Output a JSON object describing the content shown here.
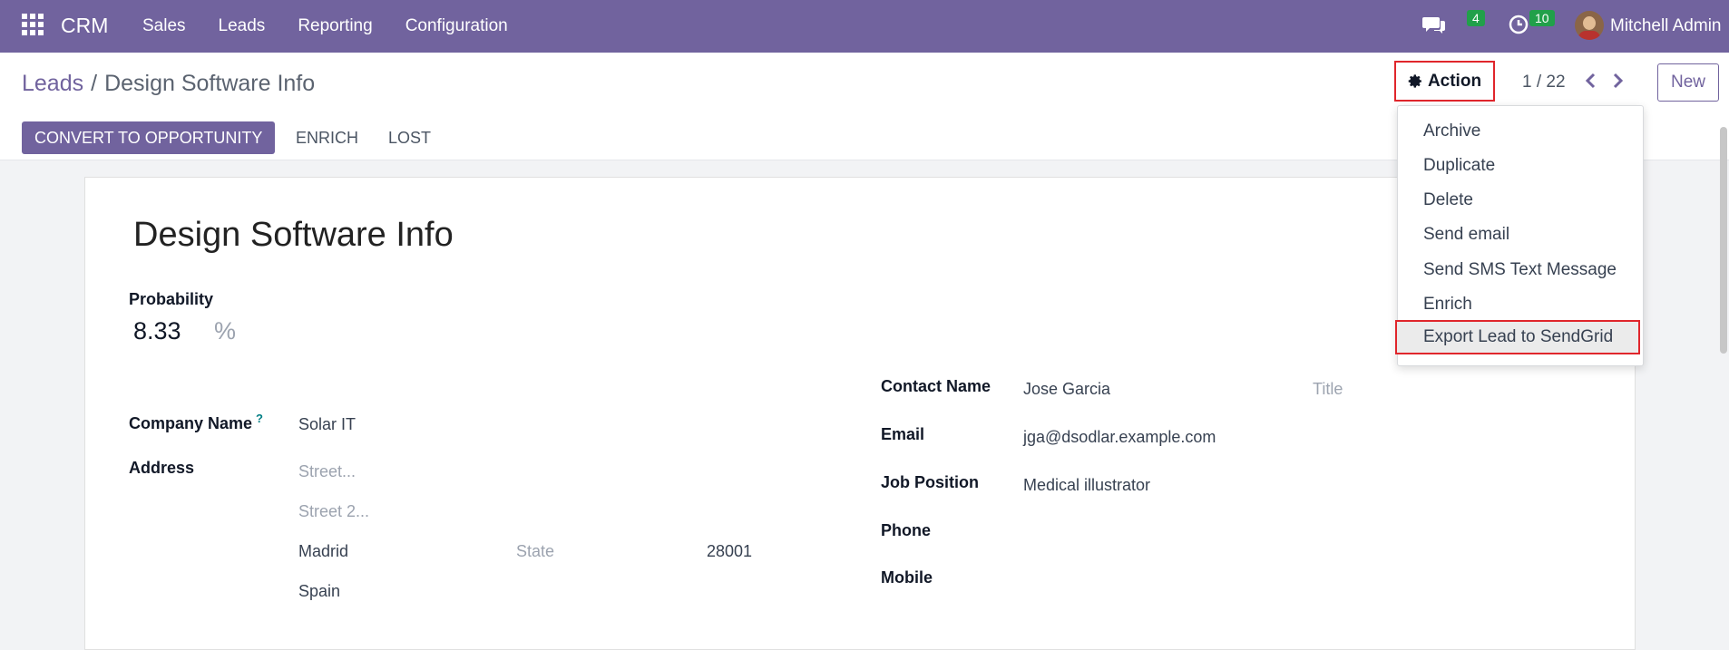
{
  "navbar": {
    "brand": "CRM",
    "menu": [
      "Sales",
      "Leads",
      "Reporting",
      "Configuration"
    ],
    "chat_badge": "4",
    "activity_badge": "10",
    "user": "Mitchell Admin"
  },
  "breadcrumb": {
    "parent": "Leads",
    "separator": "/",
    "current": "Design Software Info"
  },
  "control": {
    "action_label": "Action",
    "pager": "1 / 22",
    "new_label": "New"
  },
  "status_buttons": {
    "convert": "CONVERT TO OPPORTUNITY",
    "enrich": "ENRICH",
    "lost": "LOST"
  },
  "form": {
    "title": "Design Software Info",
    "probability_label": "Probability",
    "probability_value": "8.33",
    "probability_unit": "%",
    "company_label": "Company Name",
    "company_help": "?",
    "company_value": "Solar IT",
    "address_label": "Address",
    "street_placeholder": "Street...",
    "street2_placeholder": "Street 2...",
    "city": "Madrid",
    "state_placeholder": "State",
    "zip": "28001",
    "country": "Spain",
    "contact_label": "Contact Name",
    "contact_value": "Jose Garcia",
    "title_placeholder": "Title",
    "email_label": "Email",
    "email_value": "jga@dsodlar.example.com",
    "job_label": "Job Position",
    "job_value": "Medical illustrator",
    "phone_label": "Phone",
    "mobile_label": "Mobile"
  },
  "action_menu": [
    "Archive",
    "Duplicate",
    "Delete",
    "Send email",
    "Send SMS Text Message",
    "Enrich",
    "Export Lead to SendGrid"
  ],
  "colors": {
    "brand": "#71639e",
    "highlight": "#e0262c",
    "badge": "#21a04a"
  }
}
